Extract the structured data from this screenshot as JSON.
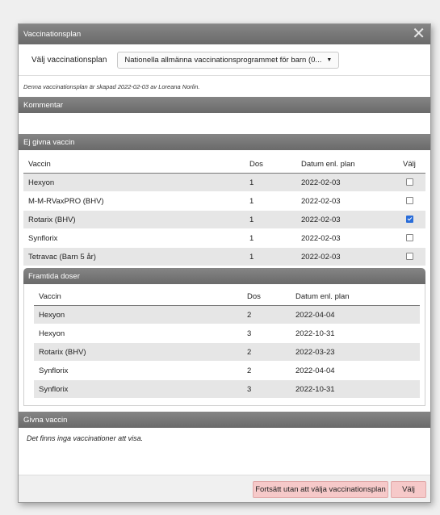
{
  "dialog": {
    "title": "Vaccinationsplan",
    "close_icon": "close-icon"
  },
  "plan": {
    "label": "Välj vaccinationsplan",
    "selected": "Nationella allmänna vaccinationsprogrammet för barn (0..."
  },
  "created_note": "Denna vaccinationsplan är skapad 2022-02-03 av Loreana Norlin.",
  "comment": {
    "title": "Kommentar"
  },
  "not_given": {
    "title": "Ej givna vaccin",
    "headers": {
      "vaccine": "Vaccin",
      "dose": "Dos",
      "date": "Datum enl. plan",
      "select": "Välj"
    },
    "rows": [
      {
        "vaccine": "Hexyon",
        "dose": "1",
        "date": "2022-02-03",
        "checked": false
      },
      {
        "vaccine": "M-M-RVaxPRO (BHV)",
        "dose": "1",
        "date": "2022-02-03",
        "checked": false
      },
      {
        "vaccine": "Rotarix (BHV)",
        "dose": "1",
        "date": "2022-02-03",
        "checked": true
      },
      {
        "vaccine": "Synflorix",
        "dose": "1",
        "date": "2022-02-03",
        "checked": false
      },
      {
        "vaccine": "Tetravac (Barn 5 år)",
        "dose": "1",
        "date": "2022-02-03",
        "checked": false
      }
    ]
  },
  "future": {
    "title": "Framtida doser",
    "headers": {
      "vaccine": "Vaccin",
      "dose": "Dos",
      "date": "Datum enl. plan"
    },
    "rows": [
      {
        "vaccine": "Hexyon",
        "dose": "2",
        "date": "2022-04-04"
      },
      {
        "vaccine": "Hexyon",
        "dose": "3",
        "date": "2022-10-31"
      },
      {
        "vaccine": "Rotarix (BHV)",
        "dose": "2",
        "date": "2022-03-23"
      },
      {
        "vaccine": "Synflorix",
        "dose": "2",
        "date": "2022-04-04"
      },
      {
        "vaccine": "Synflorix",
        "dose": "3",
        "date": "2022-10-31"
      }
    ]
  },
  "given": {
    "title": "Givna vaccin",
    "empty_message": "Det finns inga vaccinationer att visa."
  },
  "footer": {
    "continue_label": "Fortsätt utan att välja vaccinationsplan",
    "select_label": "Välj"
  }
}
